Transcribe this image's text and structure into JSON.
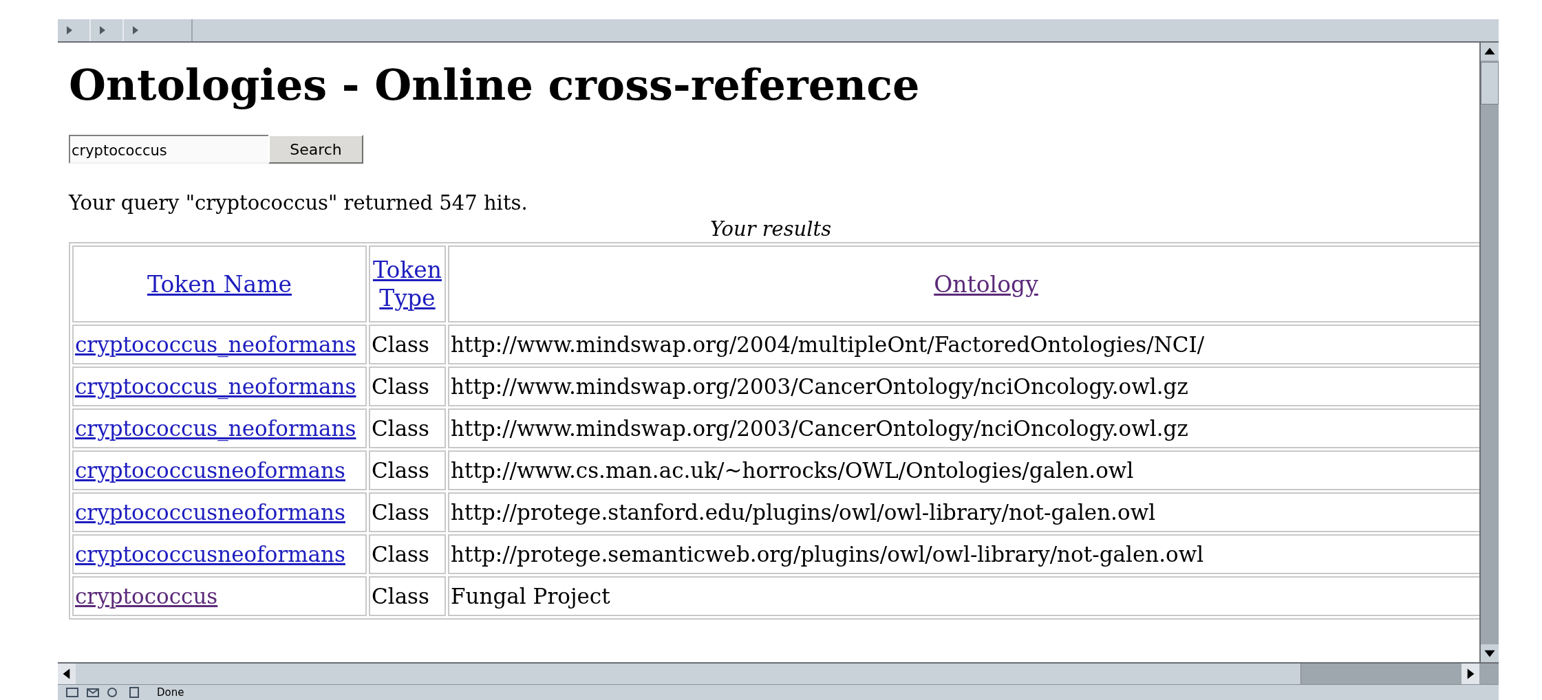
{
  "title": "Ontologies - Online cross-reference",
  "search": {
    "value": "cryptococcus",
    "button": "Search"
  },
  "summary": "Your query \"cryptococcus\" returned 547 hits.",
  "caption": "Your results",
  "table": {
    "columns": [
      {
        "label": "Token Name",
        "visited": false
      },
      {
        "label": "Token Type",
        "visited": false
      },
      {
        "label": "Ontology",
        "visited": true
      }
    ],
    "rows": [
      {
        "token": "cryptococcus_neoformans",
        "visited": false,
        "type": "Class",
        "ontology": "http://www.mindswap.org/2004/multipleOnt/FactoredOntologies/NCI/"
      },
      {
        "token": "cryptococcus_neoformans",
        "visited": false,
        "type": "Class",
        "ontology": "http://www.mindswap.org/2003/CancerOntology/nciOncology.owl.gz"
      },
      {
        "token": "cryptococcus_neoformans",
        "visited": false,
        "type": "Class",
        "ontology": "http://www.mindswap.org/2003/CancerOntology/nciOncology.owl.gz"
      },
      {
        "token": "cryptococcusneoformans",
        "visited": false,
        "type": "Class",
        "ontology": "http://www.cs.man.ac.uk/~horrocks/OWL/Ontologies/galen.owl"
      },
      {
        "token": "cryptococcusneoformans",
        "visited": false,
        "type": "Class",
        "ontology": "http://protege.stanford.edu/plugins/owl/owl-library/not-galen.owl"
      },
      {
        "token": "cryptococcusneoformans",
        "visited": false,
        "type": "Class",
        "ontology": "http://protege.semanticweb.org/plugins/owl/owl-library/not-galen.owl"
      },
      {
        "token": "cryptococcus",
        "visited": true,
        "type": "Class",
        "ontology": "Fungal Project"
      }
    ]
  },
  "status_bar": {
    "text": "Done"
  }
}
